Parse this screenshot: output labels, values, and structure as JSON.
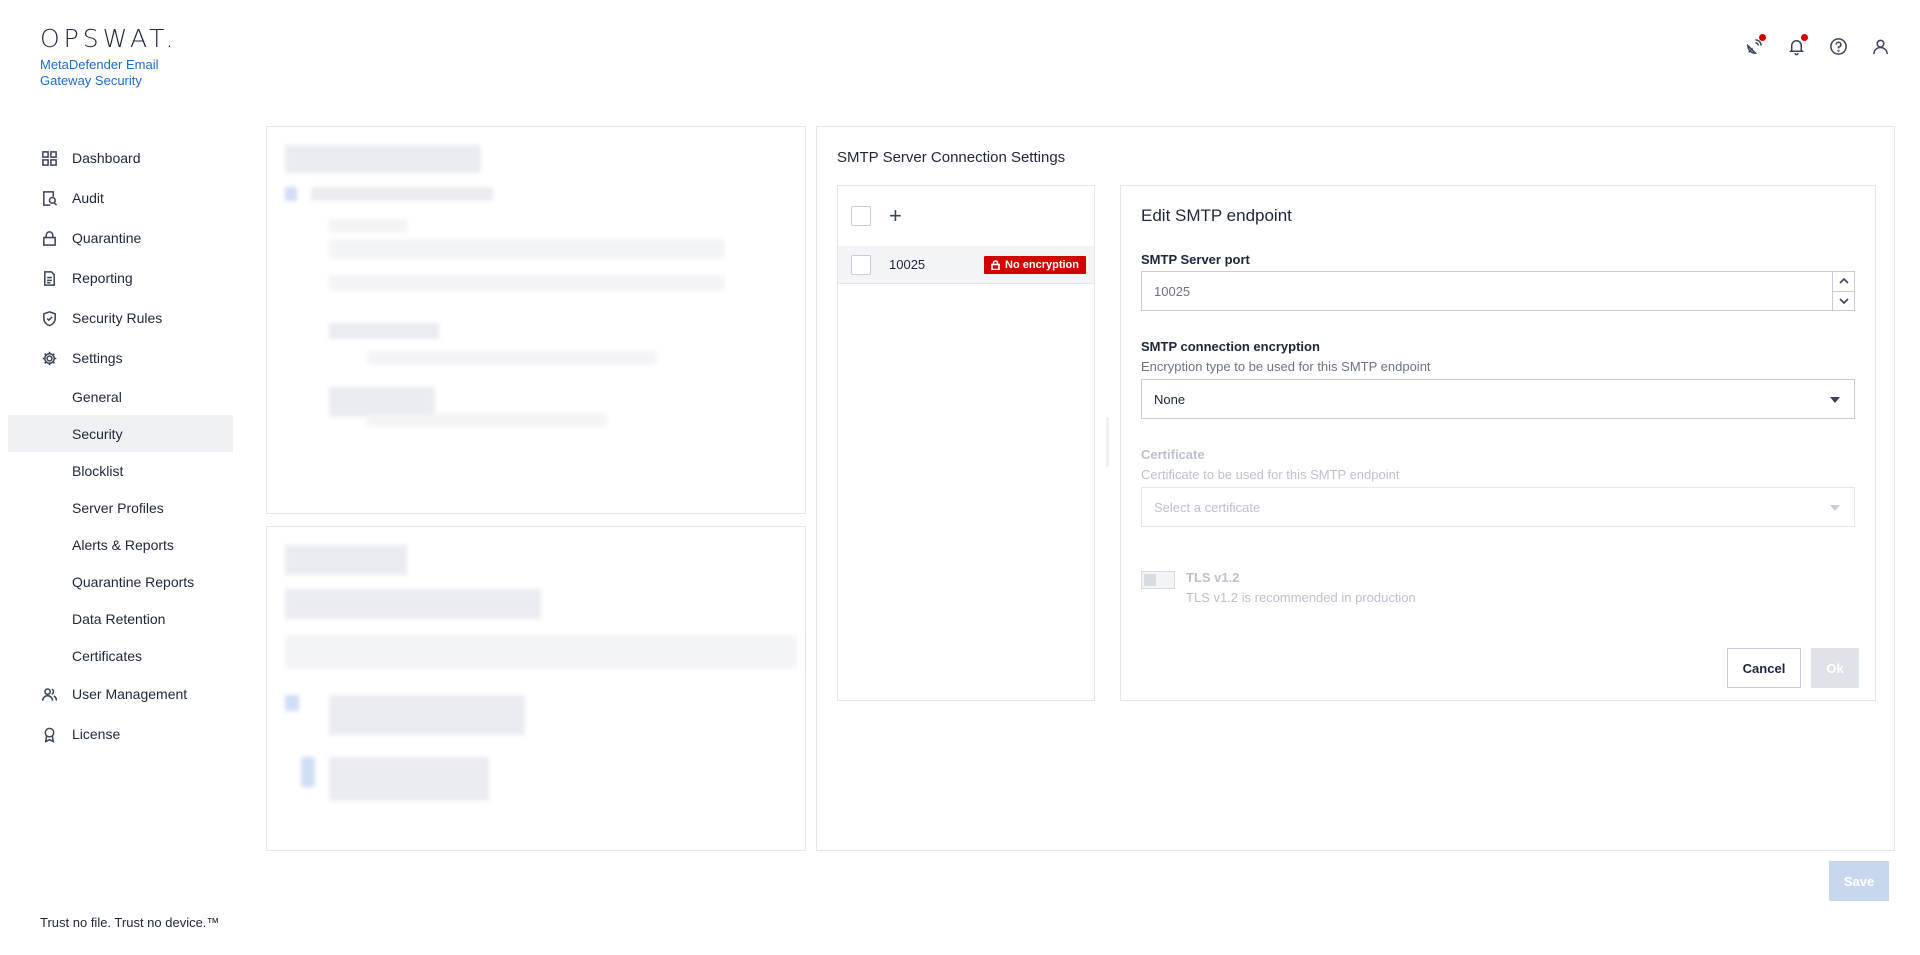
{
  "brand": {
    "logo": "OPSWAT.",
    "product": "MetaDefender Email Gateway Security"
  },
  "header": {
    "icons": [
      "satellite-dish-icon",
      "bell-icon",
      "help-circle-icon",
      "user-icon"
    ],
    "notification_color": "#d30000"
  },
  "sidebar": {
    "items": [
      {
        "label": "Dashboard",
        "icon": "dashboard-grid-icon"
      },
      {
        "label": "Audit",
        "icon": "audit-icon"
      },
      {
        "label": "Quarantine",
        "icon": "lock-icon"
      },
      {
        "label": "Reporting",
        "icon": "document-icon"
      },
      {
        "label": "Security Rules",
        "icon": "shield-check-icon"
      },
      {
        "label": "Settings",
        "icon": "gear-icon"
      }
    ],
    "settings_sub": [
      {
        "label": "General"
      },
      {
        "label": "Security",
        "active": true
      },
      {
        "label": "Blocklist"
      },
      {
        "label": "Server Profiles"
      },
      {
        "label": "Alerts & Reports"
      },
      {
        "label": "Quarantine Reports"
      },
      {
        "label": "Data Retention"
      },
      {
        "label": "Certificates"
      }
    ],
    "bottom_items": [
      {
        "label": "User Management",
        "icon": "users-icon"
      },
      {
        "label": "License",
        "icon": "award-icon"
      }
    ],
    "tagline": "Trust no file. Trust no device.™"
  },
  "panel": {
    "title": "SMTP Server Connection Settings",
    "endpoints": [
      {
        "port": "10025",
        "badge": "No encryption",
        "badge_color": "#d30000"
      }
    ],
    "edit": {
      "title": "Edit SMTP endpoint",
      "port_label": "SMTP Server port",
      "port_value": "10025",
      "encryption_label": "SMTP connection encryption",
      "encryption_hint": "Encryption type to be used for this SMTP endpoint",
      "encryption_value": "None",
      "certificate_label": "Certificate",
      "certificate_hint": "Certificate to be used for this SMTP endpoint",
      "certificate_placeholder": "Select a certificate",
      "tls_label": "TLS v1.2",
      "tls_hint": "TLS v1.2 is recommended in production",
      "tls_enabled": false,
      "cancel_label": "Cancel",
      "ok_label": "Ok"
    }
  },
  "footer": {
    "save_label": "Save"
  },
  "colors": {
    "accent": "#1d6bcd",
    "danger": "#d30000",
    "text": "#1d2639"
  }
}
